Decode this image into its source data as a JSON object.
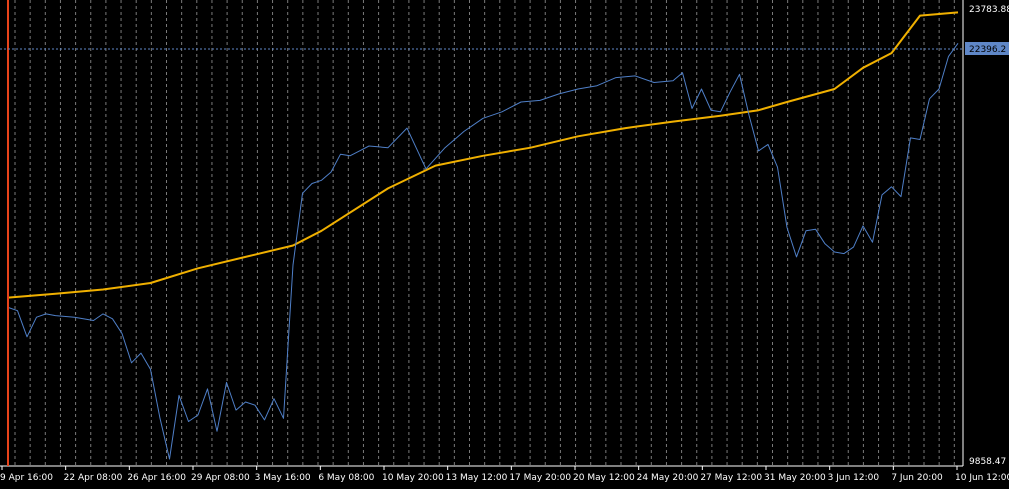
{
  "chart_data": {
    "type": "line",
    "title": "",
    "xlabel": "",
    "ylabel": "",
    "ylim": [
      9858.47,
      23783.88
    ],
    "y_axis_labels": {
      "top": "23783.88",
      "bottom": "9858.47",
      "current": "22396.2"
    },
    "x_tick_labels": [
      "9 Apr 16:00",
      "22 Apr 08:00",
      "26 Apr 16:00",
      "29 Apr 08:00",
      "3 May 16:00",
      "6 May 08:00",
      "10 May 20:00",
      "13 May 12:00",
      "17 May 20:00",
      "20 May 12:00",
      "24 May 20:00",
      "27 May 12:00",
      "31 May 20:00",
      "3 Jun 12:00",
      "7 Jun 20:00",
      "10 Jun 12:00"
    ],
    "grid": true,
    "series": [
      {
        "color": "#f0b000",
        "x": [
          0,
          5,
          10,
          15,
          20,
          25,
          30,
          33,
          40,
          45,
          50,
          55,
          60,
          65,
          70,
          75,
          79,
          82,
          87,
          90,
          93,
          96,
          100
        ],
        "values": [
          14900,
          15020,
          15150,
          15350,
          15800,
          16150,
          16500,
          16950,
          18250,
          18950,
          19250,
          19500,
          19850,
          20100,
          20300,
          20480,
          20650,
          20900,
          21300,
          21950,
          22400,
          23550,
          23650
        ]
      },
      {
        "color": "#4f7fc7",
        "x": [
          0,
          1,
          2,
          3,
          4,
          5,
          7,
          9,
          10,
          11,
          12,
          13,
          14,
          15,
          16,
          17,
          18,
          19,
          20,
          21,
          22,
          23,
          24,
          25,
          26,
          27,
          28,
          29,
          30,
          31,
          32,
          33,
          34,
          35,
          36,
          37,
          38,
          40,
          42,
          44,
          46,
          48,
          50,
          52,
          54,
          56,
          58,
          60,
          62,
          64,
          66,
          68,
          70,
          71,
          72,
          73,
          74,
          75,
          76,
          77,
          78,
          79,
          80,
          81,
          82,
          83,
          84,
          85,
          86,
          87,
          88,
          89,
          90,
          91,
          92,
          93,
          94,
          95,
          96,
          97,
          98,
          99,
          100
        ],
        "values": [
          14600,
          14500,
          13700,
          14300,
          14400,
          14350,
          14300,
          14200,
          14400,
          14250,
          13800,
          12900,
          13200,
          12700,
          11200,
          9950,
          11900,
          11100,
          11300,
          12100,
          10800,
          12300,
          11450,
          11700,
          11600,
          11150,
          11800,
          11200,
          15900,
          18100,
          18400,
          18500,
          18750,
          19300,
          19250,
          19400,
          19550,
          19500,
          20100,
          18850,
          19500,
          20000,
          20400,
          20600,
          20900,
          20950,
          21150,
          21300,
          21400,
          21650,
          21700,
          21500,
          21550,
          21800,
          20700,
          21300,
          20650,
          20600,
          21200,
          21750,
          20500,
          19400,
          19600,
          18900,
          17050,
          16150,
          16950,
          17000,
          16550,
          16300,
          16250,
          16450,
          17100,
          16600,
          18050,
          18300,
          18000,
          19800,
          19750,
          21000,
          21300,
          22300,
          22700
        ]
      }
    ]
  }
}
